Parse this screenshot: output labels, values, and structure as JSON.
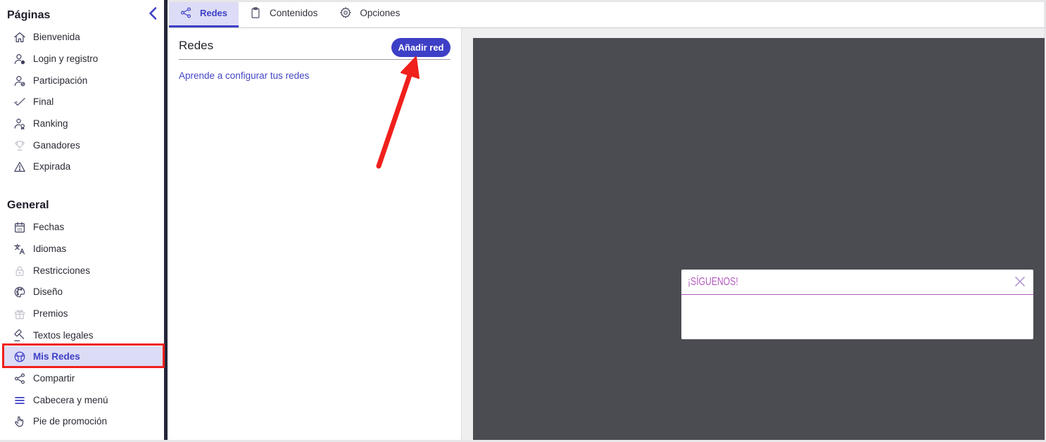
{
  "colors": {
    "accent": "#3d3fc6",
    "selected_bg": "#dcdcf6",
    "annotation": "#f0201c",
    "preview_bg": "#4b4c51",
    "popup_accent": "#b45bc0"
  },
  "sidebar": {
    "collapse_icon": "chevron-left-icon",
    "sections": [
      {
        "title": "Páginas",
        "items": [
          {
            "label": "Bienvenida",
            "icon": "home-icon"
          },
          {
            "label": "Login y registro",
            "icon": "user-settings-icon"
          },
          {
            "label": "Participación",
            "icon": "user-check-icon"
          },
          {
            "label": "Final",
            "icon": "check-icon"
          },
          {
            "label": "Ranking",
            "icon": "ranking-icon"
          },
          {
            "label": "Ganadores",
            "icon": "trophy-icon",
            "disabled": true
          },
          {
            "label": "Expirada",
            "icon": "warning-icon"
          }
        ]
      },
      {
        "title": "General",
        "items": [
          {
            "label": "Fechas",
            "icon": "calendar-icon",
            "icon_text": "03"
          },
          {
            "label": "Idiomas",
            "icon": "translate-icon"
          },
          {
            "label": "Restricciones",
            "icon": "lock-icon",
            "disabled": true
          },
          {
            "label": "Diseño",
            "icon": "palette-icon"
          },
          {
            "label": "Premios",
            "icon": "gift-icon",
            "disabled": true
          },
          {
            "label": "Textos legales",
            "icon": "gavel-icon"
          },
          {
            "label": "Mis Redes",
            "icon": "globe-icon",
            "selected": true
          },
          {
            "label": "Compartir",
            "icon": "share-icon"
          },
          {
            "label": "Cabecera y menú",
            "icon": "menu-icon"
          },
          {
            "label": "Pie de promoción",
            "icon": "hand-pointer-icon"
          }
        ]
      }
    ]
  },
  "tabs": [
    {
      "label": "Redes",
      "icon": "share-icon",
      "active": true
    },
    {
      "label": "Contenidos",
      "icon": "clipboard-icon"
    },
    {
      "label": "Opciones",
      "icon": "gear-icon"
    }
  ],
  "networks_panel": {
    "title": "Redes",
    "add_button": "Añadir red",
    "help_link": "Aprende a configurar tus redes"
  },
  "preview": {
    "popup_title": "¡SÍGUENOS!",
    "close_icon": "close-icon"
  }
}
